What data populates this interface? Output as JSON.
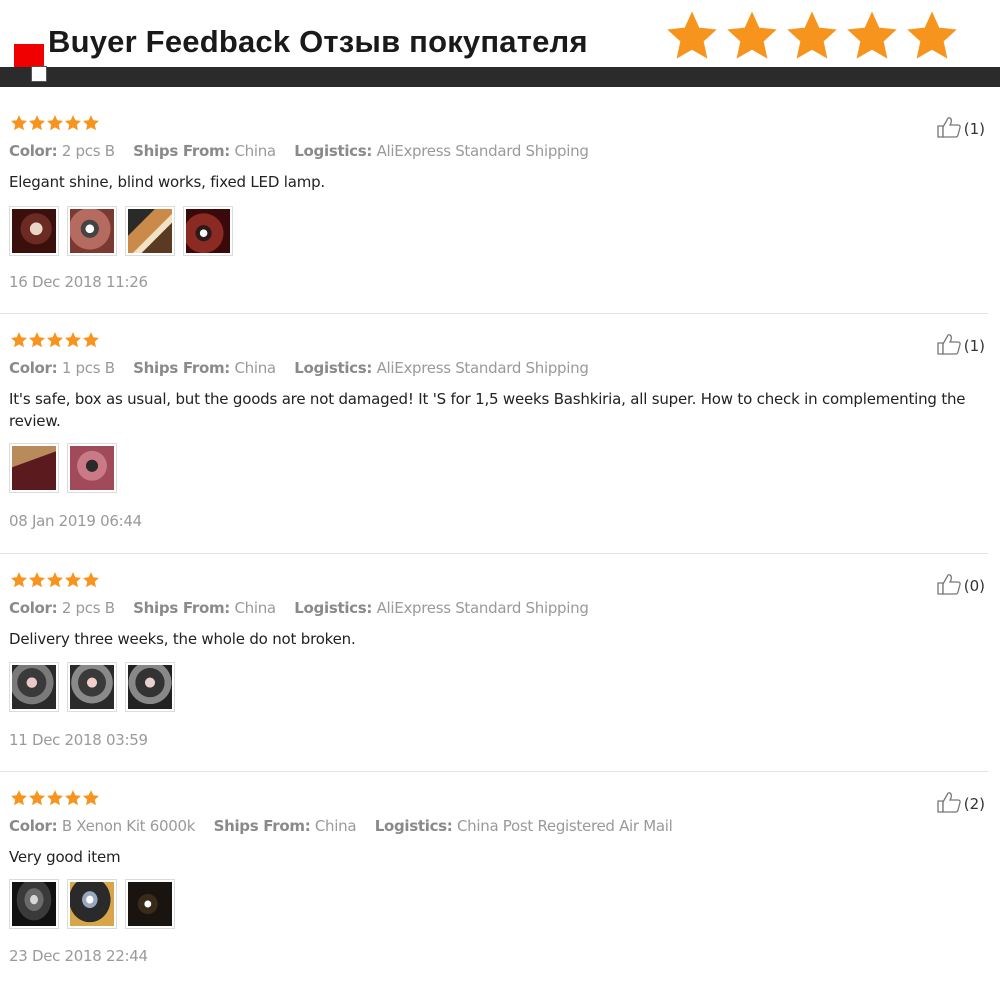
{
  "header": {
    "title": "Buyer Feedback Отзыв покупателя",
    "star_color": "#f7941d",
    "star_count": 5
  },
  "colors": {
    "accent_red": "#f00000",
    "banner_bar": "#2b2b2b",
    "rating_star": "#f7941d"
  },
  "reviews": [
    {
      "rating": 5,
      "color_label": "Color:",
      "color_value": "2 pcs B",
      "ships_label": "Ships From:",
      "ships_value": "China",
      "logistics_label": "Logistics:",
      "logistics_value": "AliExpress Standard Shipping",
      "text": "Elegant shine, blind works, fixed LED lamp.",
      "photo_count": 4,
      "date": "16 Dec 2018 11:26",
      "helpful_count": "(1)"
    },
    {
      "rating": 5,
      "color_label": "Color:",
      "color_value": "1 pcs B",
      "ships_label": "Ships From:",
      "ships_value": "China",
      "logistics_label": "Logistics:",
      "logistics_value": "AliExpress Standard Shipping",
      "text": "It's safe, box as usual, but the goods are not damaged! It 'S for 1,5 weeks Bashkiria, all super. How to check in complementing the review.",
      "photo_count": 2,
      "date": "08 Jan 2019 06:44",
      "helpful_count": "(1)"
    },
    {
      "rating": 5,
      "color_label": "Color:",
      "color_value": "2 pcs B",
      "ships_label": "Ships From:",
      "ships_value": "China",
      "logistics_label": "Logistics:",
      "logistics_value": "AliExpress Standard Shipping",
      "text": "Delivery three weeks, the whole do not broken.",
      "photo_count": 3,
      "date": "11 Dec 2018 03:59",
      "helpful_count": "(0)"
    },
    {
      "rating": 5,
      "color_label": "Color:",
      "color_value": "B Xenon Kit 6000k",
      "ships_label": "Ships From:",
      "ships_value": "China",
      "logistics_label": "Logistics:",
      "logistics_value": "China Post Registered Air Mail",
      "text": "Very good item",
      "photo_count": 3,
      "date": "23 Dec 2018 22:44",
      "helpful_count": "(2)"
    }
  ],
  "icons": {
    "rating_star": "star-icon",
    "helpful": "thumbs-up-icon",
    "photo": "photo-thumbnail"
  }
}
